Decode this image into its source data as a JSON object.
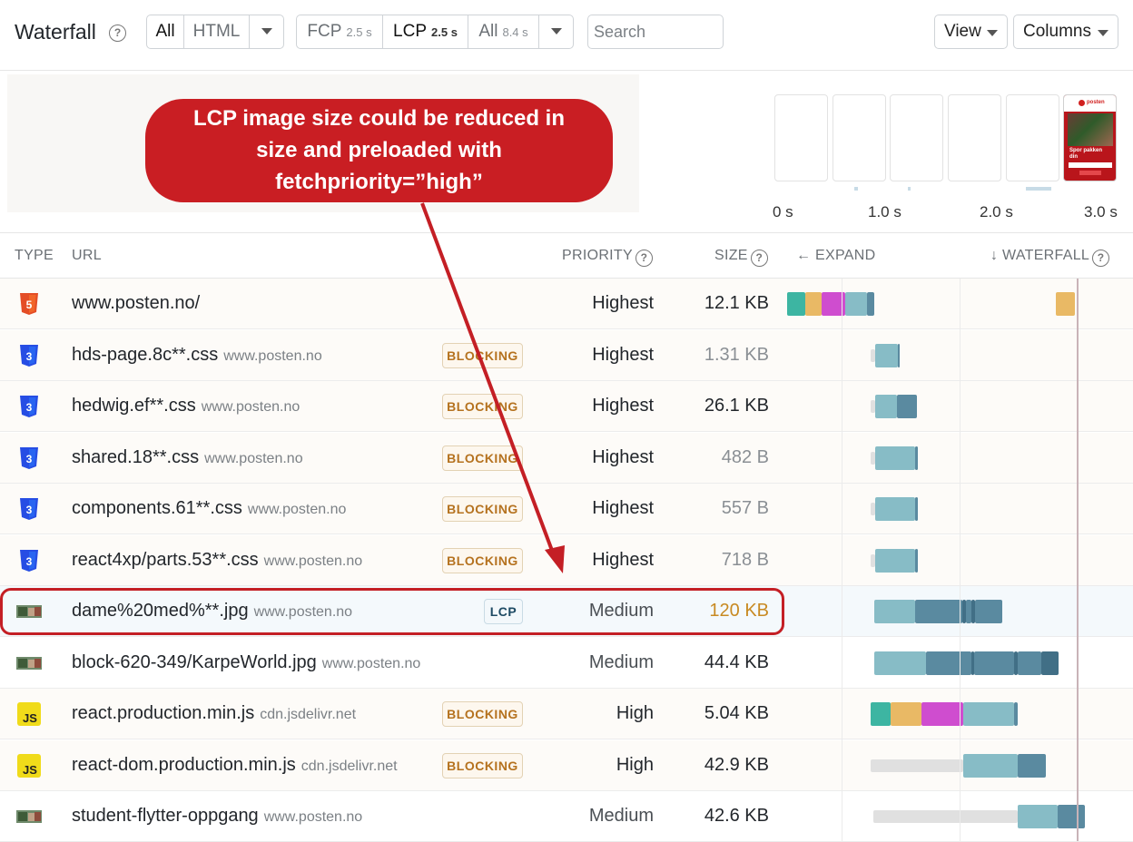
{
  "toolbar": {
    "title": "Waterfall",
    "type_filter": {
      "all": "All",
      "html": "HTML"
    },
    "metric_filter": {
      "fcp_label": "FCP",
      "fcp_value": "2.5 s",
      "lcp_label": "LCP",
      "lcp_value": "2.5 s",
      "all_label": "All",
      "all_value": "8.4 s"
    },
    "search_placeholder": "Search",
    "view_label": "View",
    "columns_label": "Columns"
  },
  "annotation": {
    "line1": "LCP image size could be reduced in",
    "line2": "size and preloaded with",
    "line3": "fetchpriority=”high”",
    "color": "#c91e23"
  },
  "filmstrip": {
    "last_frame": {
      "logo": "posten",
      "text_line1": "Spor pakken",
      "text_line2": "din"
    },
    "ticks": [
      "0 s",
      "1.0 s",
      "2.0 s",
      "3.0 s"
    ]
  },
  "table": {
    "headers": {
      "type": "TYPE",
      "url": "URL",
      "priority": "PRIORITY",
      "size": "SIZE",
      "expand": "← EXPAND",
      "waterfall": "↓ WATERFALL"
    },
    "rows": [
      {
        "type": "html",
        "name": "www.posten.no/",
        "host": "",
        "badge": "",
        "priority": "Highest",
        "size": "12.1 KB"
      },
      {
        "type": "css",
        "name": "hds-page.8c**.css",
        "host": "www.posten.no",
        "badge": "BLOCKING",
        "priority": "Highest",
        "size": "1.31 KB"
      },
      {
        "type": "css",
        "name": "hedwig.ef**.css",
        "host": "www.posten.no",
        "badge": "BLOCKING",
        "priority": "Highest",
        "size": "26.1 KB"
      },
      {
        "type": "css",
        "name": "shared.18**.css",
        "host": "www.posten.no",
        "badge": "BLOCKING",
        "priority": "Highest",
        "size": "482 B"
      },
      {
        "type": "css",
        "name": "components.61**.css",
        "host": "www.posten.no",
        "badge": "BLOCKING",
        "priority": "Highest",
        "size": "557 B"
      },
      {
        "type": "css",
        "name": "react4xp/parts.53**.css",
        "host": "www.posten.no",
        "badge": "BLOCKING",
        "priority": "Highest",
        "size": "718 B"
      },
      {
        "type": "img",
        "name": "dame%20med%**.jpg",
        "host": "www.posten.no",
        "badge": "LCP",
        "priority": "Medium",
        "size": "120 KB"
      },
      {
        "type": "img",
        "name": "block-620-349/KarpeWorld.jpg",
        "host": "www.posten.no",
        "badge": "",
        "priority": "Medium",
        "size": "44.4 KB"
      },
      {
        "type": "js",
        "name": "react.production.min.js",
        "host": "cdn.jsdelivr.net",
        "badge": "BLOCKING",
        "priority": "High",
        "size": "5.04 KB"
      },
      {
        "type": "js",
        "name": "react-dom.production.min.js",
        "host": "cdn.jsdelivr.net",
        "badge": "BLOCKING",
        "priority": "High",
        "size": "42.9 KB"
      },
      {
        "type": "img",
        "name": "student-flytter-oppgang",
        "host": "www.posten.no",
        "badge": "",
        "priority": "Medium",
        "size": "42.6 KB"
      }
    ]
  },
  "colors": {
    "wait": "#e0e0e0",
    "dns": "#3db5a2",
    "connect": "#e9b965",
    "ssl": "#cf4dcf",
    "ttfb": "#87bcc6",
    "download": "#5a8aa0",
    "download_dark": "#416f86",
    "lcp_size": "#c88a22",
    "highlight": "#c41f25"
  }
}
